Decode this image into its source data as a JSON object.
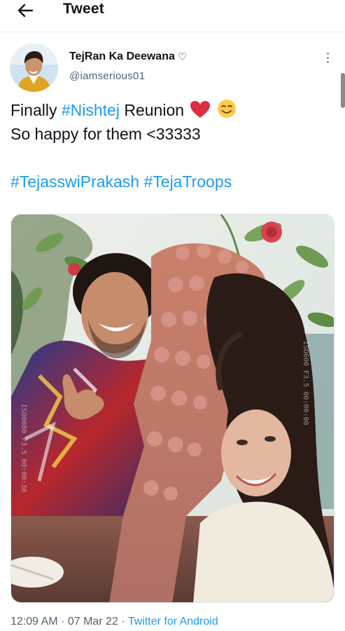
{
  "header": {
    "title": "Tweet",
    "back_icon": "arrow-left-icon"
  },
  "author": {
    "display_name": "TejRan Ka Deewana",
    "badge_symbol": "♡",
    "handle": "@iamserious01",
    "avatar_icon": "profile-avatar"
  },
  "tweet": {
    "line1_prefix": "Finally ",
    "line1_tag": "#Nishtej",
    "line1_suffix": " Reunion",
    "line1_emojis": [
      "red-heart-emoji",
      "smiling-face-emoji"
    ],
    "line2": "So happy for them <33333",
    "tag1": "#TejasswiPrakash",
    "tag2": "#TejaTroops"
  },
  "media": {
    "watermark_left": "ISO0080 F3.5 00:00:30",
    "watermark_right": "ISO600 F3.5 00:00:00"
  },
  "meta": {
    "time": "12:09 AM",
    "separator": " · ",
    "date": "07 Mar 22",
    "source": "Twitter for Android"
  },
  "colors": {
    "link": "#1d9bf0",
    "secondary_text": "#536471",
    "text": "#0f1419"
  }
}
